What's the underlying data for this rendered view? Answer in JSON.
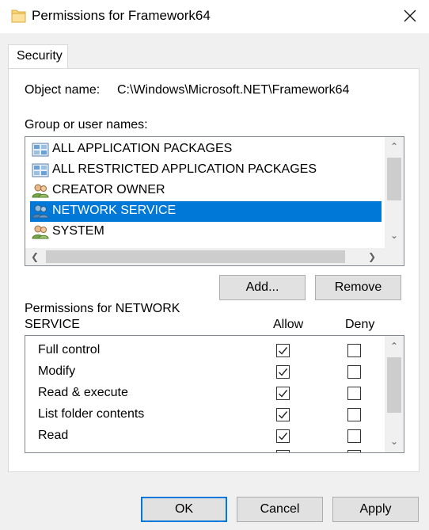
{
  "window": {
    "title": "Permissions for Framework64",
    "folder_icon": "folder-icon",
    "close_icon": "close-icon"
  },
  "tabs": [
    {
      "label": "Security",
      "active": true
    }
  ],
  "object": {
    "label": "Object name:",
    "value": "C:\\Windows\\Microsoft.NET\\Framework64"
  },
  "groups": {
    "label": "Group or user names:",
    "items": [
      {
        "label": "ALL APPLICATION PACKAGES",
        "icon": "packages-icon",
        "selected": false
      },
      {
        "label": "ALL RESTRICTED APPLICATION PACKAGES",
        "icon": "packages-icon",
        "selected": false
      },
      {
        "label": "CREATOR OWNER",
        "icon": "users-icon",
        "selected": false
      },
      {
        "label": "NETWORK SERVICE",
        "icon": "users-icon",
        "selected": true
      },
      {
        "label": "SYSTEM",
        "icon": "users-icon",
        "selected": false
      }
    ],
    "add_button": "Add...",
    "remove_button": "Remove"
  },
  "permissions": {
    "title": "Permissions for NETWORK SERVICE",
    "allow_header": "Allow",
    "deny_header": "Deny",
    "rows": [
      {
        "label": "Full control",
        "allow": true,
        "deny": false
      },
      {
        "label": "Modify",
        "allow": true,
        "deny": false
      },
      {
        "label": "Read & execute",
        "allow": true,
        "deny": false
      },
      {
        "label": "List folder contents",
        "allow": true,
        "deny": false
      },
      {
        "label": "Read",
        "allow": true,
        "deny": false
      }
    ]
  },
  "footer": {
    "ok": "OK",
    "cancel": "Cancel",
    "apply": "Apply"
  }
}
